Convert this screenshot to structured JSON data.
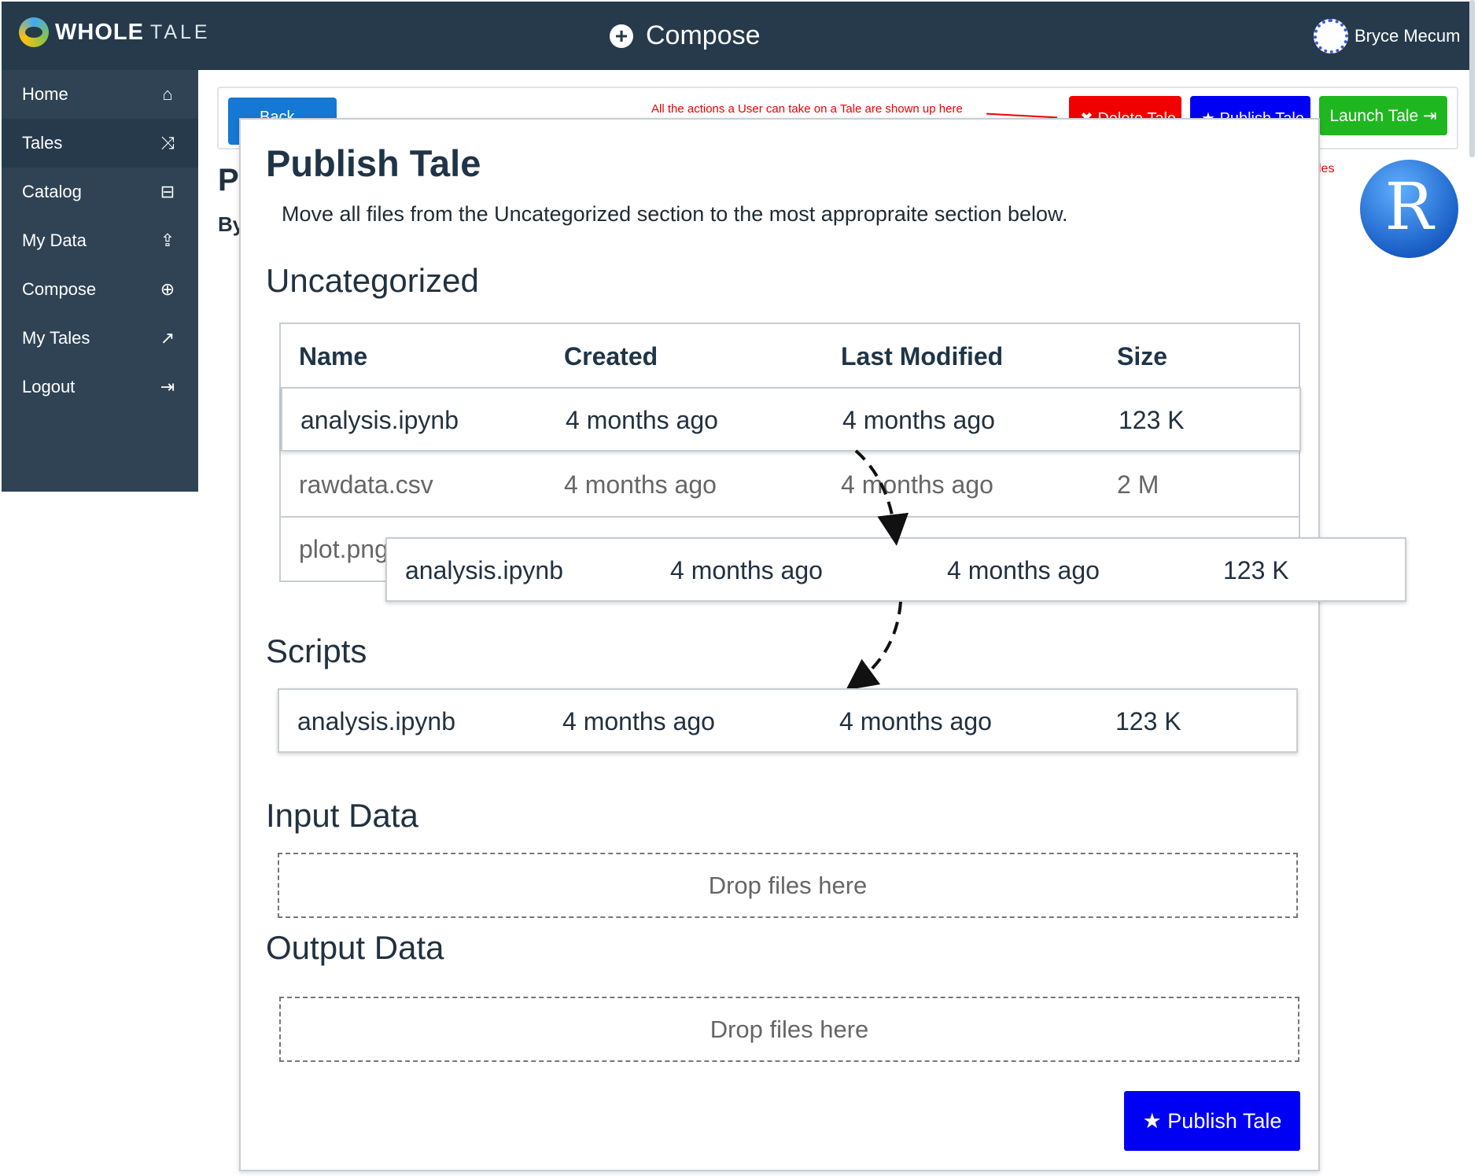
{
  "app": {
    "logo_word1": "WHOLE",
    "logo_word2": "TALE",
    "header_title": "Compose",
    "header_title_icon": "plus-circle-icon",
    "user_name": "Bryce Mecum",
    "user_avatar_icon": "avatar-icon"
  },
  "sidebar": {
    "items": [
      {
        "label": "Home",
        "icon": "home-icon",
        "glyph": "⌂"
      },
      {
        "label": "Tales",
        "icon": "shuffle-icon",
        "glyph": "⤨"
      },
      {
        "label": "Catalog",
        "icon": "drive-icon",
        "glyph": "⊟"
      },
      {
        "label": "My Data",
        "icon": "upload-icon",
        "glyph": "⇪"
      },
      {
        "label": "Compose",
        "icon": "plus-circle-icon",
        "glyph": "⊕"
      },
      {
        "label": "My Tales",
        "icon": "line-chart-icon",
        "glyph": "↗"
      },
      {
        "label": "Logout",
        "icon": "logout-icon",
        "glyph": "⇥"
      }
    ],
    "active": "Tales"
  },
  "background_page": {
    "back_label": "Back",
    "annotation": "All the actions a User can take on a Tale are shown up here",
    "delete_label": "✖ Delete Tale",
    "publish_label": "★ Publish Tale",
    "launch_label": "Launch Tale ⇥",
    "title_fragment": "P",
    "by_fragment": "By",
    "annotation_fragment": "les",
    "r_logo_text": "R",
    "colors": {
      "delete": "#f00000",
      "publish": "#0000f5",
      "launch": "#1fb71f",
      "back": "#1478d4"
    }
  },
  "modal": {
    "title": "Publish Tale",
    "instructions": "Move all files from the Uncategorized section to the most appropraite section below.",
    "uncategorized_heading": "Uncategorized",
    "columns": [
      "Name",
      "Created",
      "Last Modified",
      "Size"
    ],
    "rows": [
      {
        "name": "analysis.ipynb",
        "created": "4 months ago",
        "modified": "4 months ago",
        "size": "123 K"
      },
      {
        "name": "rawdata.csv",
        "created": "4 months ago",
        "modified": "4 months ago",
        "size": "2 M"
      },
      {
        "name": "plot.png",
        "created": "",
        "modified": "",
        "size": ""
      }
    ],
    "dragging_row": {
      "name": "analysis.ipynb",
      "created": "4 months ago",
      "modified": "4 months ago",
      "size": "123 K"
    },
    "scripts_heading": "Scripts",
    "scripts_rows": [
      {
        "name": "analysis.ipynb",
        "created": "4 months ago",
        "modified": "4 months ago",
        "size": "123 K"
      }
    ],
    "input_heading": "Input Data",
    "input_drop": "Drop files here",
    "output_heading": "Output Data",
    "output_drop": "Drop files here",
    "publish_button": "★ Publish Tale",
    "publish_color": "#0000f5"
  }
}
